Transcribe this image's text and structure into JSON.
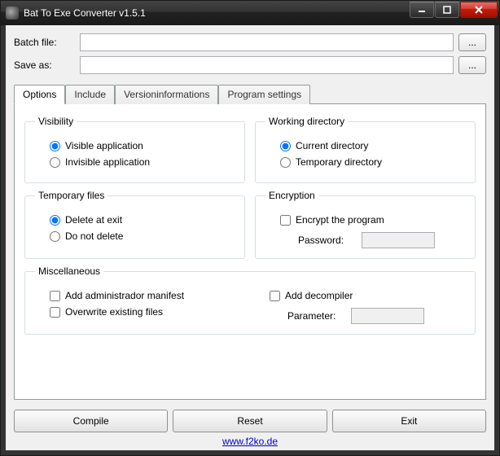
{
  "window": {
    "title": "Bat To Exe Converter v1.5.1"
  },
  "files": {
    "batch_label": "Batch file:",
    "batch_value": "",
    "saveas_label": "Save as:",
    "saveas_value": "",
    "browse_label": "..."
  },
  "tabs": {
    "options": "Options",
    "include": "Include",
    "versioninfo": "Versioninformations",
    "programsettings": "Program settings"
  },
  "options": {
    "visibility": {
      "legend": "Visibility",
      "visible": "Visible application",
      "invisible": "Invisible application"
    },
    "workdir": {
      "legend": "Working directory",
      "current": "Current directory",
      "temp": "Temporary directory"
    },
    "tempfiles": {
      "legend": "Temporary files",
      "delete": "Delete at exit",
      "keep": "Do not delete"
    },
    "encryption": {
      "legend": "Encryption",
      "encrypt": "Encrypt the program",
      "password_label": "Password:",
      "password_value": ""
    },
    "misc": {
      "legend": "Miscellaneous",
      "admin": "Add administrador manifest",
      "overwrite": "Overwrite existing files",
      "decompiler": "Add decompiler",
      "parameter_label": "Parameter:",
      "parameter_value": ""
    }
  },
  "buttons": {
    "compile": "Compile",
    "reset": "Reset",
    "exit": "Exit"
  },
  "footer": {
    "link": "www.f2ko.de"
  }
}
